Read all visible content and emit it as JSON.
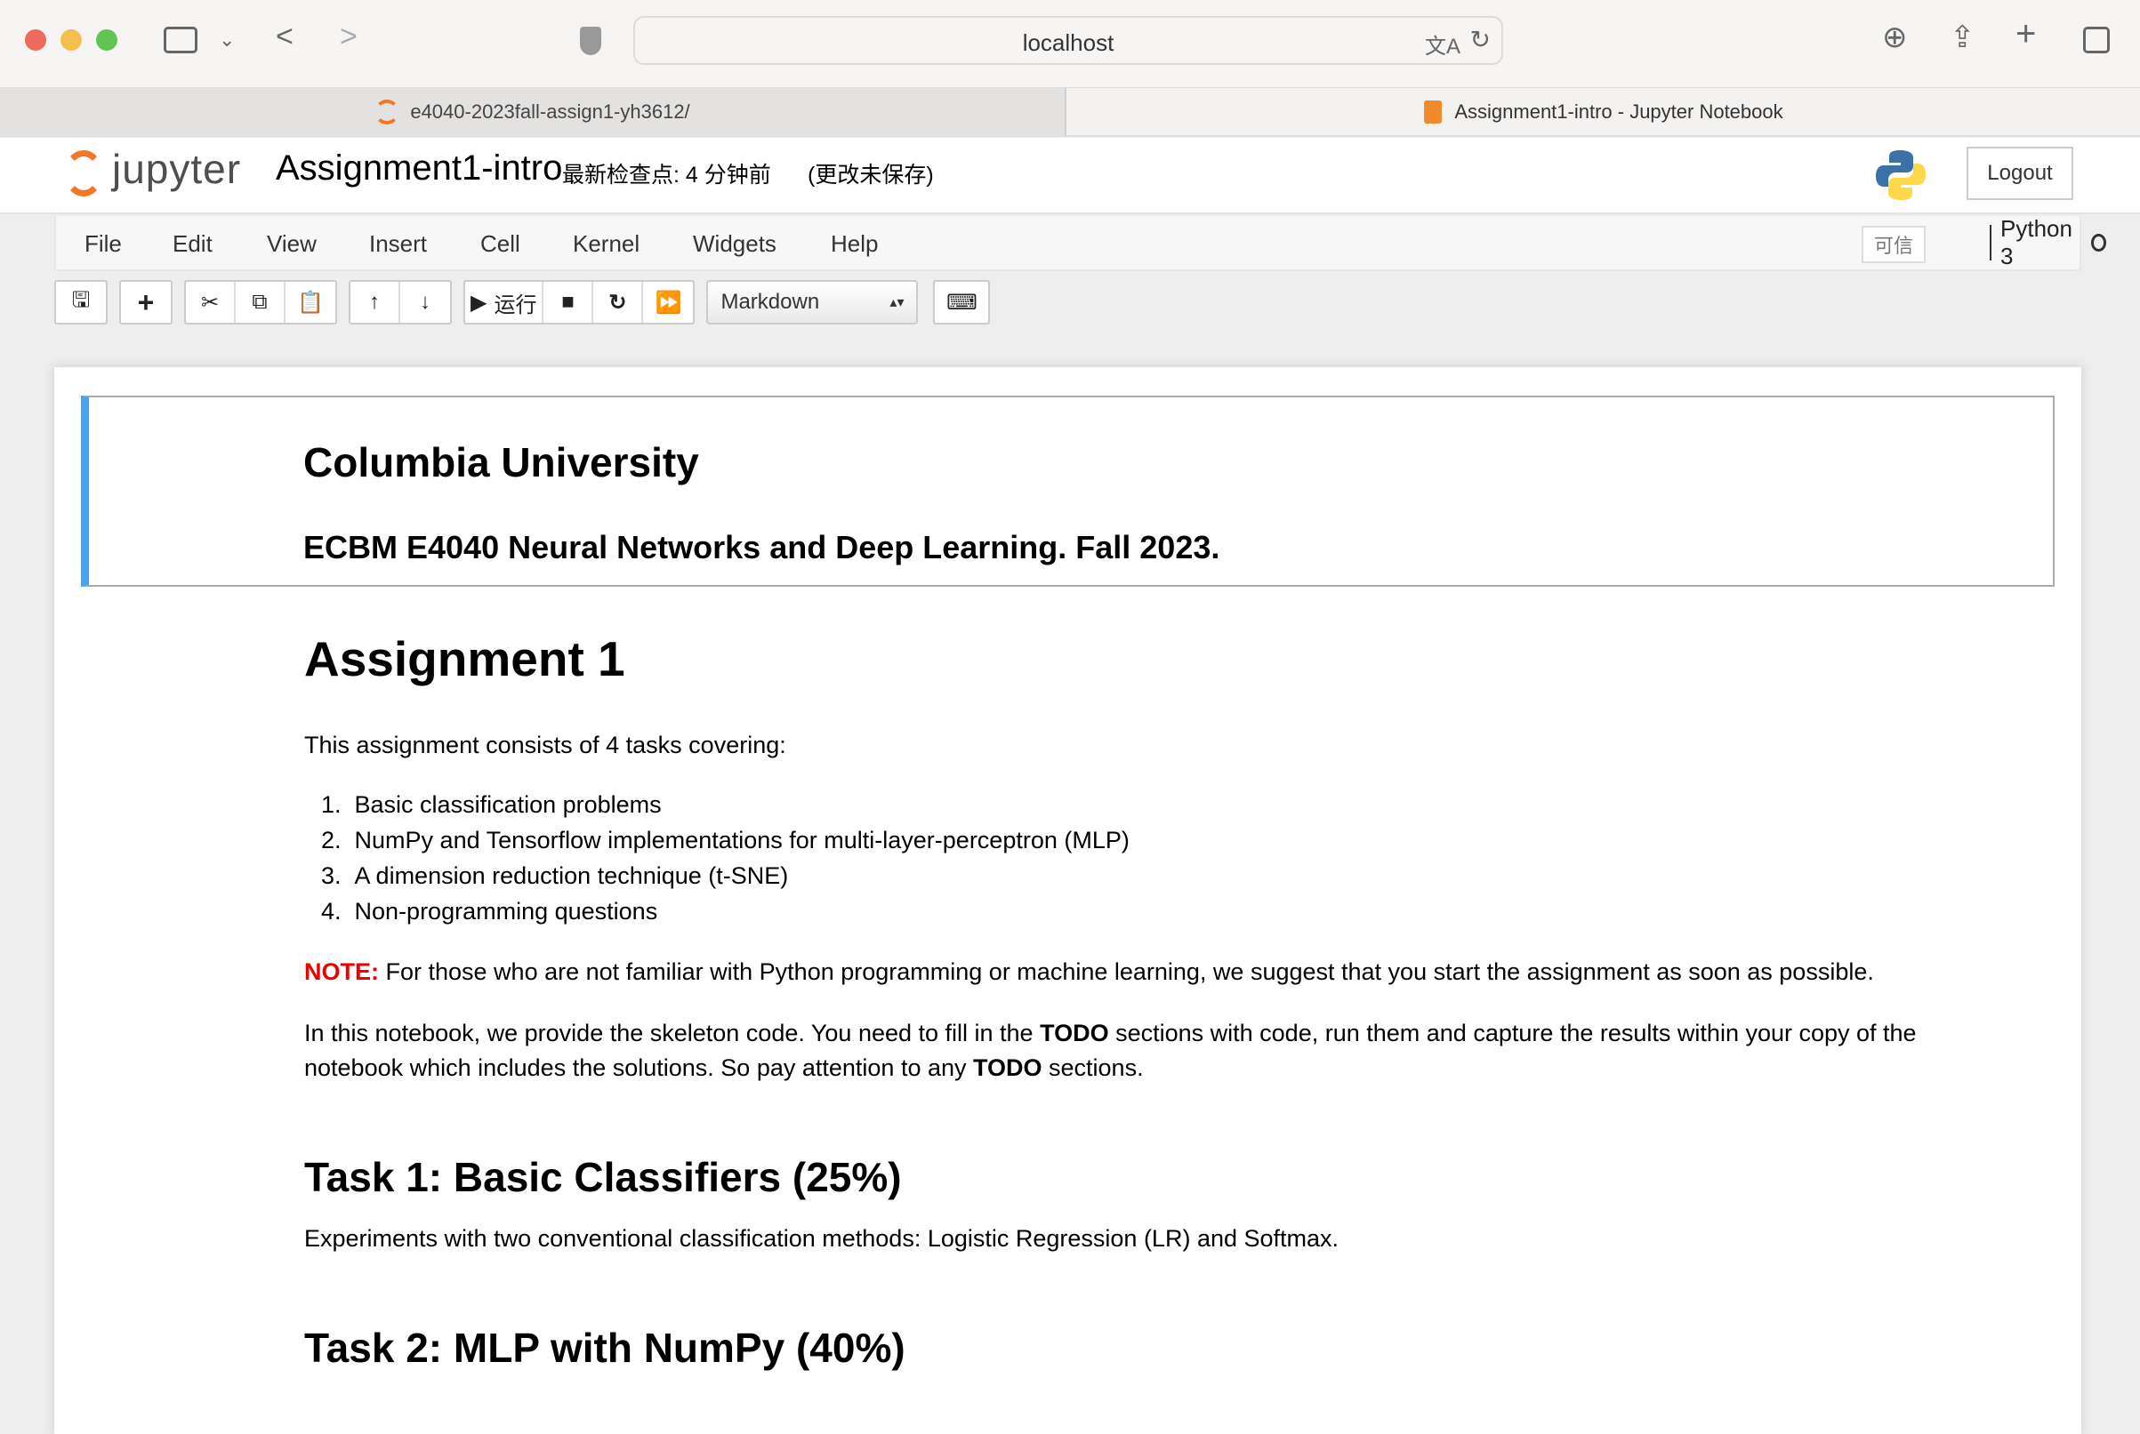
{
  "browser": {
    "url": "localhost",
    "tabs": [
      {
        "label": "e4040-2023fall-assign1-yh3612/"
      },
      {
        "label": "Assignment1-intro - Jupyter Notebook"
      }
    ]
  },
  "header": {
    "logo": "jupyter",
    "title": "Assignment1-intro",
    "checkpoint": "最新检查点: 4 分钟前",
    "unsaved": "(更改未保存)",
    "logout": "Logout"
  },
  "menu": {
    "items": [
      "File",
      "Edit",
      "View",
      "Insert",
      "Cell",
      "Kernel",
      "Widgets",
      "Help"
    ],
    "trusted": "可信",
    "kernel": "Python 3"
  },
  "toolbar": {
    "run_label": "运行",
    "cell_type": "Markdown"
  },
  "cell1": {
    "university": "Columbia University",
    "course": "ECBM E4040 Neural Networks and Deep Learning. Fall 2023."
  },
  "content": {
    "title": "Assignment 1",
    "intro": "This assignment consists of 4 tasks covering:",
    "list": [
      "Basic classification problems",
      "NumPy and Tensorflow implementations for multi-layer-perceptron (MLP)",
      "A dimension reduction technique (t-SNE)",
      "Non-programming questions"
    ],
    "note_label": "NOTE:",
    "note": " For those who are not familiar with Python programming or machine learning, we suggest that you start the assignment as soon as possible.",
    "para_a": "In this notebook, we provide the skeleton code. You need to fill in the ",
    "todo": "TODO",
    "para_b": " sections with code, run them and capture the results within your copy of the",
    "para_c": "notebook which includes the solutions. So pay attention to any ",
    "para_d": " sections.",
    "task1": "Task 1: Basic Classifiers (25%)",
    "task1_desc": "Experiments with two conventional classification methods: Logistic Regression (LR) and Softmax.",
    "task2": "Task 2: MLP with NumPy (40%)"
  }
}
